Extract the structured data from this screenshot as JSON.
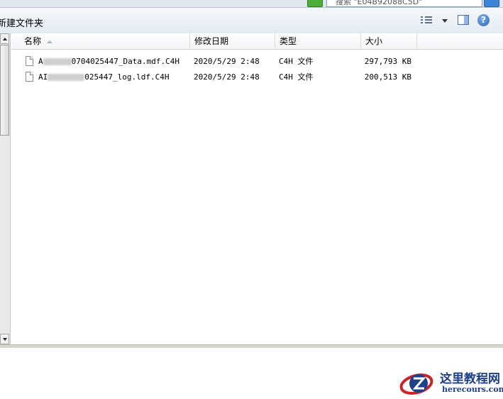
{
  "topbar": {
    "search_placeholder": "搜索 \"E04B92088C5D\""
  },
  "toolbar": {
    "new_folder_label": "新建文件夹",
    "help_label": "?"
  },
  "columns": {
    "name": "名称",
    "date": "修改日期",
    "type": "类型",
    "size": "大小"
  },
  "files": [
    {
      "name_prefix": "A",
      "name_suffix": "0704025447_Data.mdf.C4H",
      "date": "2020/5/29 2:48",
      "type": "C4H 文件",
      "size": "297,793 KB"
    },
    {
      "name_prefix": "AI",
      "name_suffix": "025447_log.ldf.C4H",
      "date": "2020/5/29 2:48",
      "type": "C4H 文件",
      "size": "200,513 KB"
    }
  ],
  "watermark": {
    "title": "这里教程网",
    "url": "herecours.com"
  },
  "colors": {
    "accent": "#1e3f8a",
    "logo_red": "#c8252b"
  }
}
